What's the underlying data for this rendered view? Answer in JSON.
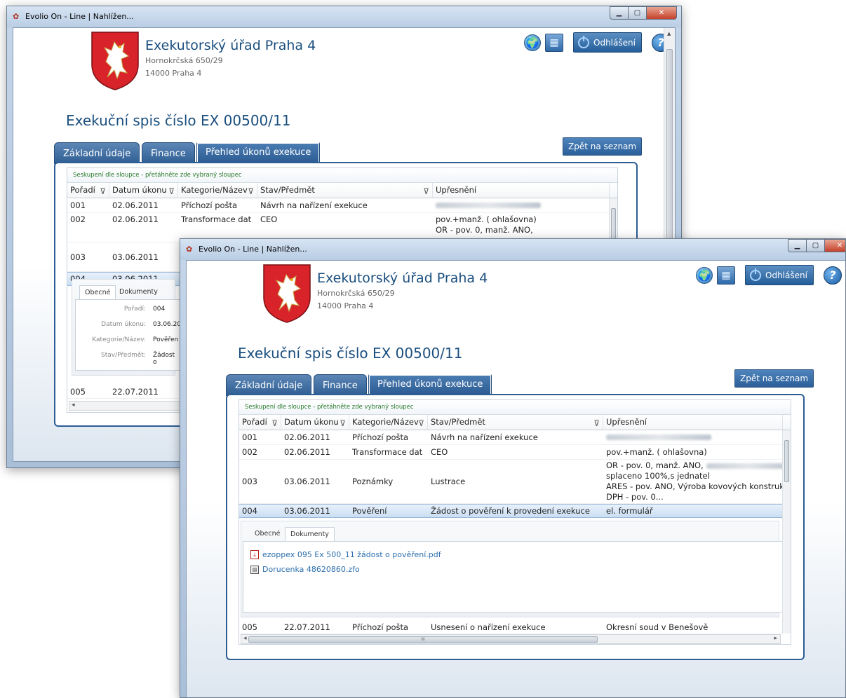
{
  "window": {
    "title": "Evolio On - Line | Nahlížen..."
  },
  "office": {
    "name": "Exekutorský úřad Praha 4",
    "street": "Hornokrčská 650/29",
    "city": "14000   Praha 4"
  },
  "header": {
    "logout_label": "Odhlášení",
    "help_glyph": "?"
  },
  "case": {
    "title": "Exekuční spis číslo EX 00500/11"
  },
  "tabs": [
    "Základní údaje",
    "Finance",
    "Přehled úkonů exekuce"
  ],
  "back_label": "Zpět na seznam",
  "grouping_hint": "Seskupení dle sloupce - přetáhněte zde vybraný sloupec",
  "columns": [
    "Pořadí",
    "Datum úkonu",
    "Kategorie/Název",
    "Stav/Předmět",
    "Upřesnění"
  ],
  "rows": [
    {
      "n": "001",
      "date": "02.06.2011",
      "cat": "Příchozí pošta",
      "state": "Návrh na nařízení exekuce",
      "note": ""
    },
    {
      "n": "002",
      "date": "02.06.2011",
      "cat": "Transformace dat",
      "state": "CEO",
      "note": "pov.+manž. ( ohlašovna)"
    },
    {
      "n": "003",
      "date": "03.06.2011",
      "cat": "Poznámky",
      "state": "Lustrace",
      "note1": "OR - pov. 0, manž. ANO,",
      "note2": "splaceno 100%,s jednatel",
      "note3": "ARES - pov. ANO, Výroba kovových konstrukcí a",
      "note4": "DPH - pov. 0..."
    },
    {
      "n": "004",
      "date": "03.06.2011",
      "cat": "Pověření",
      "state": "Žádost o pověření k provedení exekuce",
      "note": "el. formulář"
    },
    {
      "n": "005",
      "date": "22.07.2011",
      "cat": "Příchozí pošta",
      "state": "Usnesení o nařízení exekuce",
      "note": "Okresní soud v Benešově"
    }
  ],
  "detail_tabs": [
    "Obecné",
    "Dokumenty"
  ],
  "documents": [
    "ezoppex 095 Ex 500_11 žádost o pověření.pdf",
    "Dorucenka 48620860.zfo"
  ],
  "back_detail": {
    "labels": [
      "Pořadí:",
      "Datum úkonu:",
      "Kategorie/Název:",
      "Stav/Předmět:"
    ],
    "values": [
      "004",
      "03.06.20",
      "Pověřen",
      "Žádost o"
    ]
  },
  "back_note_002_line2": "OR - pov. 0, manž. ANO,",
  "scroll_thumb_glyph": "III",
  "icons": {
    "globe": "🌍",
    "book": "▦",
    "pdf": "⤓",
    "zfo": "▤",
    "filter": "⊽"
  }
}
